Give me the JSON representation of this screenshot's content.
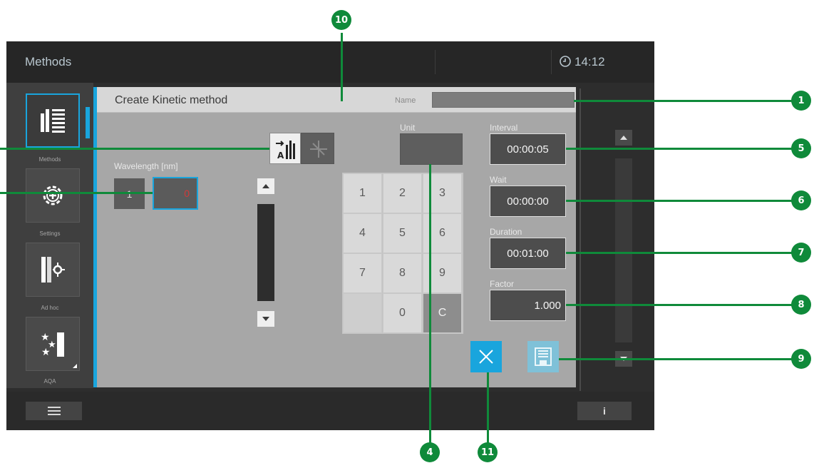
{
  "topbar": {
    "title": "Methods",
    "time": "14:12",
    "clock_icon": "clock-icon"
  },
  "panel": {
    "header_title": "Create Kinetic method",
    "name_label": "Name",
    "name_value": "",
    "unit_label": "Unit",
    "unit_value": "",
    "wavelength_label": "Wavelength [nm]",
    "wavelength_index": "1",
    "wavelength_value": "0"
  },
  "sidebar": {
    "items": [
      {
        "label": "Methods",
        "icon": "methods-list-icon"
      },
      {
        "label": "Settings",
        "icon": "settings-gear-icon"
      },
      {
        "label": "Ad hoc",
        "icon": "ad-hoc-measure-icon"
      },
      {
        "label": "AQA",
        "icon": "aqa-stars-icon"
      }
    ]
  },
  "fields": {
    "interval_label": "Interval",
    "interval_value": "00:00:05",
    "wait_label": "Wait",
    "wait_value": "00:00:00",
    "duration_label": "Duration",
    "duration_value": "00:01:00",
    "factor_label": "Factor",
    "factor_value": "1.000"
  },
  "keypad": [
    "1",
    "2",
    "3",
    "4",
    "5",
    "6",
    "7",
    "8",
    "9",
    "",
    "0",
    "C"
  ],
  "bottombar": {
    "menu_icon": "hamburger-menu-icon",
    "info_label": "i"
  },
  "callouts": {
    "c1": "1",
    "c4": "4",
    "c5": "5",
    "c6": "6",
    "c7": "7",
    "c8": "8",
    "c9": "9",
    "c10": "10",
    "c11": "11"
  },
  "colors": {
    "accent": "#19a5dd",
    "callout": "#0f8a3a"
  }
}
